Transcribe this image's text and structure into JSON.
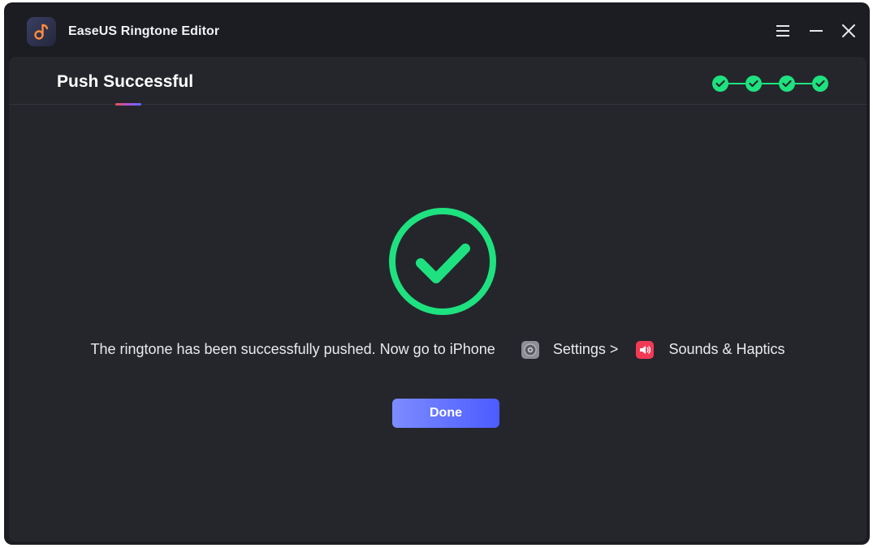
{
  "app": {
    "title": "EaseUS Ringtone Editor",
    "logo_icon": "music-note-logo-icon"
  },
  "window_controls": {
    "menu_icon": "hamburger-icon",
    "minimize_icon": "minimize-icon",
    "close_icon": "close-icon"
  },
  "header": {
    "title": "Push Successful",
    "steps": [
      {
        "status": "done",
        "icon": "check-icon"
      },
      {
        "status": "done",
        "icon": "check-icon"
      },
      {
        "status": "done",
        "icon": "check-icon"
      },
      {
        "status": "done",
        "icon": "check-icon"
      }
    ]
  },
  "main": {
    "success_icon": "success-check-circle-icon",
    "message": {
      "text": "The ringtone has been successfully pushed. Now go to iPhone",
      "settings_label": "Settings >",
      "sounds_label": "Sounds & Haptics",
      "settings_icon": "settings-gear-icon",
      "sounds_icon": "speaker-icon"
    },
    "done_button": "Done"
  },
  "colors": {
    "window_bg": "#1c1d22",
    "panel_bg": "#25262c",
    "accent_green": "#1ee27f",
    "button_start": "#7d8cff",
    "button_end": "#4b5cff"
  }
}
